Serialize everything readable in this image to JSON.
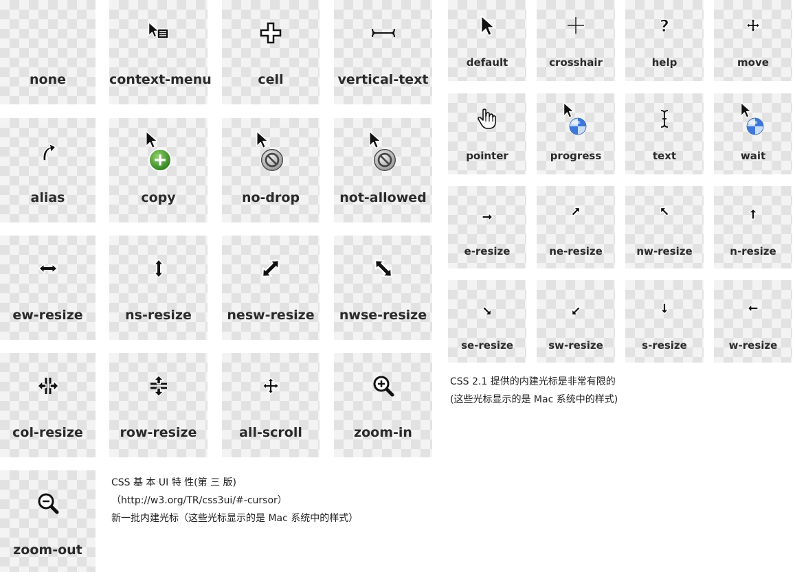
{
  "left_grid": {
    "tiles": [
      {
        "label": "none",
        "icon": "none-icon"
      },
      {
        "label": "context-menu",
        "icon": "context-menu-icon"
      },
      {
        "label": "cell",
        "icon": "cell-icon"
      },
      {
        "label": "vertical-text",
        "icon": "vertical-text-icon"
      },
      {
        "label": "alias",
        "icon": "alias-icon"
      },
      {
        "label": "copy",
        "icon": "copy-icon"
      },
      {
        "label": "no-drop",
        "icon": "no-drop-icon"
      },
      {
        "label": "not-allowed",
        "icon": "not-allowed-icon"
      },
      {
        "label": "ew-resize",
        "icon": "ew-resize-icon"
      },
      {
        "label": "ns-resize",
        "icon": "ns-resize-icon"
      },
      {
        "label": "nesw-resize",
        "icon": "nesw-resize-icon"
      },
      {
        "label": "nwse-resize",
        "icon": "nwse-resize-icon"
      },
      {
        "label": "col-resize",
        "icon": "col-resize-icon"
      },
      {
        "label": "row-resize",
        "icon": "row-resize-icon"
      },
      {
        "label": "all-scroll",
        "icon": "all-scroll-icon"
      },
      {
        "label": "zoom-in",
        "icon": "zoom-in-icon"
      },
      {
        "label": "zoom-out",
        "icon": "zoom-out-icon"
      }
    ],
    "caption": {
      "line1": "CSS 基 本 UI 特 性(第 三 版)",
      "line2": "（http://w3.org/TR/css3ui/#-cursor）",
      "line3": "新一批内建光标（这些光标显示的是 Mac 系统中的样式）"
    }
  },
  "right_grid": {
    "tiles": [
      {
        "label": "default",
        "icon": "default-arrow-icon"
      },
      {
        "label": "crosshair",
        "icon": "crosshair-icon"
      },
      {
        "label": "help",
        "icon": "help-icon"
      },
      {
        "label": "move",
        "icon": "move-icon"
      },
      {
        "label": "pointer",
        "icon": "pointer-hand-icon"
      },
      {
        "label": "progress",
        "icon": "progress-icon"
      },
      {
        "label": "text",
        "icon": "text-ibeam-icon"
      },
      {
        "label": "wait",
        "icon": "wait-icon"
      },
      {
        "label": "e-resize",
        "icon": "e-resize-icon"
      },
      {
        "label": "ne-resize",
        "icon": "ne-resize-icon"
      },
      {
        "label": "nw-resize",
        "icon": "nw-resize-icon"
      },
      {
        "label": "n-resize",
        "icon": "n-resize-icon"
      },
      {
        "label": "se-resize",
        "icon": "se-resize-icon"
      },
      {
        "label": "sw-resize",
        "icon": "sw-resize-icon"
      },
      {
        "label": "s-resize",
        "icon": "s-resize-icon"
      },
      {
        "label": "w-resize",
        "icon": "w-resize-icon"
      }
    ],
    "caption": {
      "line1": "CSS 2.1 提供的内建光标是非常有限的",
      "line2": "(这些光标显示的是 Mac 系统中的样式)"
    }
  },
  "colors": {
    "copy_badge": "#3f9a2c",
    "ball_blue": "#3d78d8",
    "tile_bg": "#f3f3f3"
  }
}
